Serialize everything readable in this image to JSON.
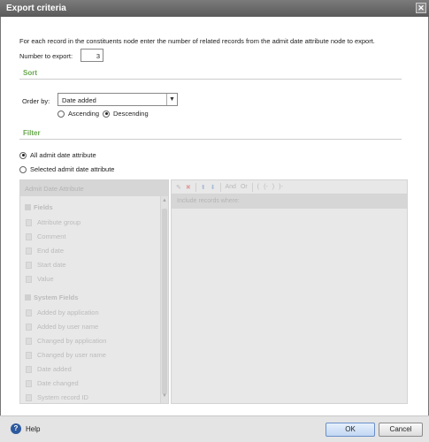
{
  "window": {
    "title": "Export criteria",
    "close_glyph": "✕"
  },
  "description": "For each record in the constituents node enter the number of related records from the admit date attribute node to export.",
  "number_to_export": {
    "label": "Number to export:",
    "value": "3"
  },
  "sort": {
    "section_title": "Sort",
    "order_by_label": "Order by:",
    "order_by_value": "Date added",
    "ascending_label": "Ascending",
    "descending_label": "Descending",
    "selected": "descending"
  },
  "filter": {
    "section_title": "Filter",
    "all_label": "All admit date attribute",
    "selected_label": "Selected admit date attribute",
    "selected": "all"
  },
  "field_list": {
    "header": "Admit Date Attribute",
    "groups": [
      {
        "label": "Fields",
        "items": [
          "Attribute group",
          "Comment",
          "End date",
          "Start date",
          "Value"
        ]
      },
      {
        "label": "System Fields",
        "items": [
          "Added by application",
          "Added by user name",
          "Changed by application",
          "Changed by user name",
          "Date added",
          "Date changed",
          "System record ID"
        ]
      }
    ]
  },
  "criteria": {
    "header": "Include records where:",
    "toolbar": [
      "edit",
      "delete",
      "up",
      "down",
      "And",
      "Or",
      "(",
      "(-",
      ")",
      ")-"
    ]
  },
  "footer": {
    "help_label": "Help",
    "ok_label": "OK",
    "cancel_label": "Cancel"
  },
  "colors": {
    "section_green": "#6aa84f",
    "title_bar": "#6a6a6a",
    "help_icon": "#2e5a9e"
  }
}
